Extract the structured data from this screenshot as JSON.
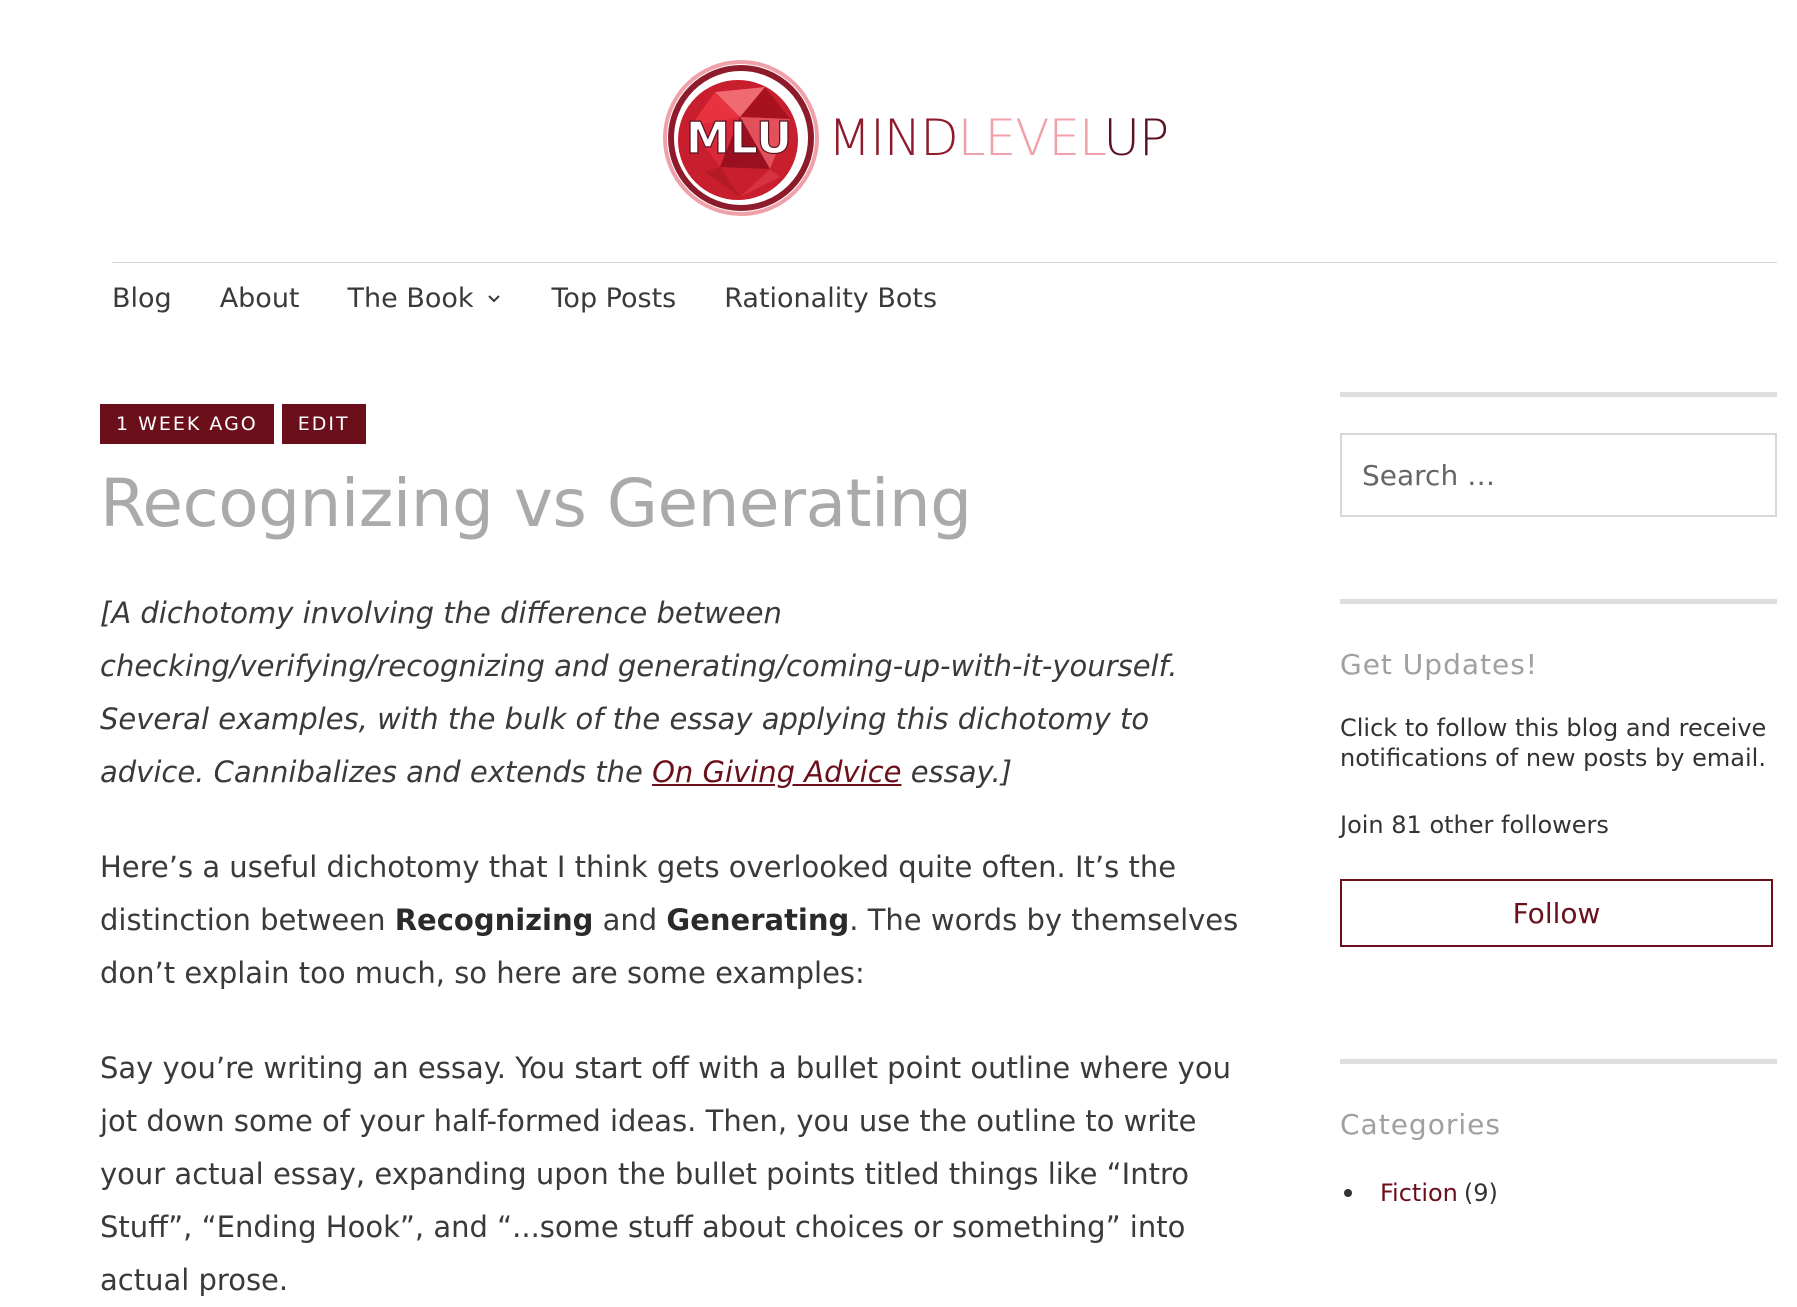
{
  "logo": {
    "mark_text": "MLU",
    "wordmark": {
      "mind": "MIND",
      "level": "LEVEL",
      "up": "UP"
    },
    "colors": {
      "primary": "#8e1b2b",
      "light": "#f0a0a8",
      "dark": "#5a1220"
    }
  },
  "nav": {
    "items": [
      {
        "label": "Blog"
      },
      {
        "label": "About"
      },
      {
        "label": "The Book",
        "has_dropdown": true
      },
      {
        "label": "Top Posts"
      },
      {
        "label": "Rationality Bots"
      }
    ]
  },
  "post": {
    "date_badge": "1 WEEK AGO",
    "edit_badge": "EDIT",
    "title": "Recognizing vs Generating",
    "intro_before_link": "[A dichotomy involving the difference between checking/verifying/recognizing and generating/coming-up-with-it-yourself. Several examples, with the bulk of the essay applying this dichotomy to advice. Cannibalizes and extends the ",
    "intro_link": "On Giving Advice",
    "intro_after_link": " essay.]",
    "para1": {
      "before": "Here’s a useful dichotomy that I think gets overlooked quite often. It’s the distinction between ",
      "bold1": "Recognizing",
      "middle": " and ",
      "bold2": "Generating",
      "after": ". The words by themselves don’t explain too much, so here are some examples:"
    },
    "para2": "Say you’re writing an essay. You start off with a bullet point outline where you jot down some of your half-formed ideas. Then, you use the outline to write your actual essay, expanding upon the bullet points titled things like “Intro Stuff”, “Ending Hook”, and “...some stuff about choices or something” into actual prose."
  },
  "sidebar": {
    "search": {
      "placeholder": "Search …"
    },
    "updates": {
      "title": "Get Updates!",
      "text": "Click to follow this blog and receive notifications of new posts by email.",
      "followers": "Join 81 other followers",
      "follow_label": "Follow"
    },
    "categories": {
      "title": "Categories",
      "items": [
        {
          "name": "Fiction",
          "count": "(9)"
        }
      ]
    }
  },
  "colors": {
    "accent": "#6b0f1a",
    "title_gray": "#aaaaaa",
    "text": "#3a3a3a",
    "rule": "#dedede"
  }
}
